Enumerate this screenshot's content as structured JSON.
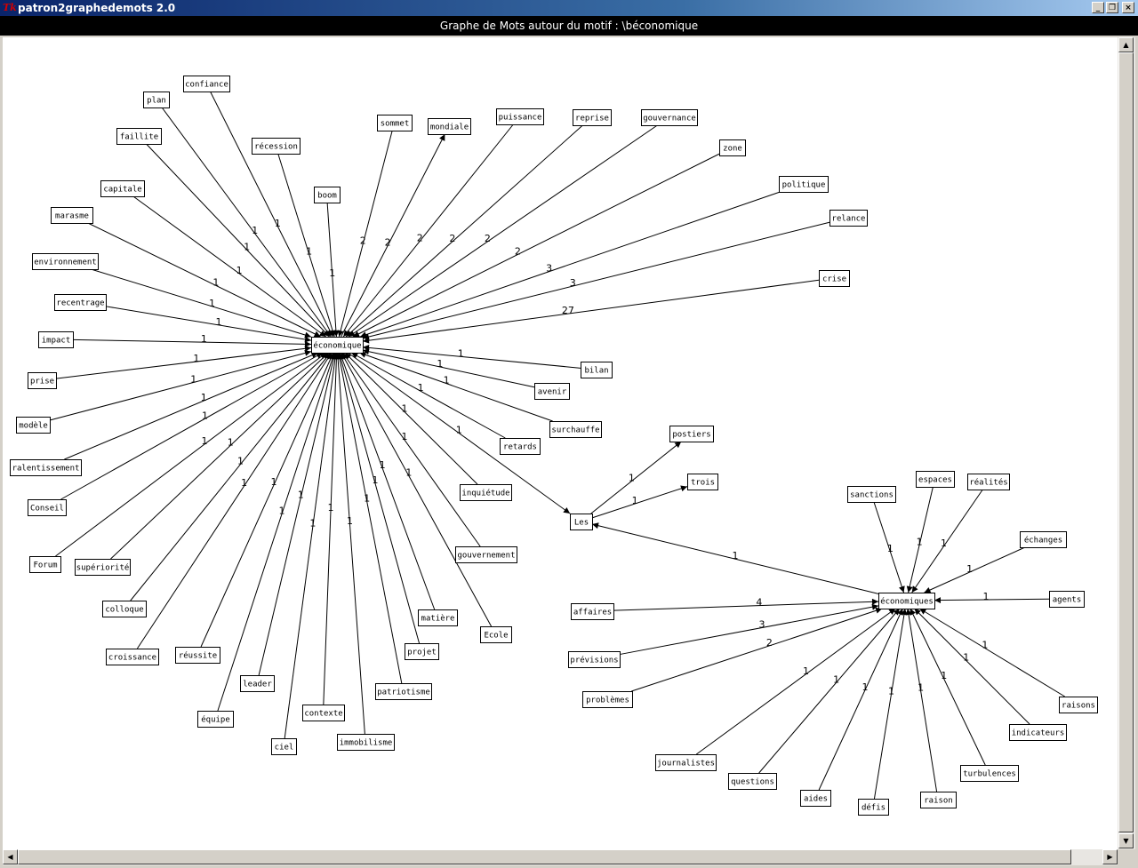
{
  "window": {
    "title": "patron2graphedemots 2.0",
    "icon": "tk-feather-icon",
    "buttons": [
      "_",
      "❐",
      "×"
    ]
  },
  "graph_title": "Graphe de Mots autour du motif : \\béconomique",
  "hub_labels": {
    "economique": "économique",
    "les": "Les",
    "economiques": "économiques"
  },
  "economique_neighbors": [
    {
      "label": "confiance",
      "weight": "1",
      "dir": "to_hub"
    },
    {
      "label": "plan",
      "weight": "1",
      "dir": "to_hub"
    },
    {
      "label": "faillite",
      "weight": "1",
      "dir": "to_hub"
    },
    {
      "label": "récession",
      "weight": "1",
      "dir": "to_hub"
    },
    {
      "label": "boom",
      "weight": "1",
      "dir": "to_hub"
    },
    {
      "label": "sommet",
      "weight": "2",
      "dir": "to_hub"
    },
    {
      "label": "mondiale",
      "weight": "2",
      "dir": "from_hub"
    },
    {
      "label": "puissance",
      "weight": "2",
      "dir": "to_hub"
    },
    {
      "label": "reprise",
      "weight": "2",
      "dir": "to_hub"
    },
    {
      "label": "gouvernance",
      "weight": "2",
      "dir": "to_hub"
    },
    {
      "label": "zone",
      "weight": "2",
      "dir": "to_hub"
    },
    {
      "label": "politique",
      "weight": "3",
      "dir": "to_hub"
    },
    {
      "label": "relance",
      "weight": "3",
      "dir": "to_hub"
    },
    {
      "label": "crise",
      "weight": "27",
      "dir": "to_hub"
    },
    {
      "label": "capitale",
      "weight": "1",
      "dir": "to_hub"
    },
    {
      "label": "marasme",
      "weight": "1",
      "dir": "to_hub"
    },
    {
      "label": "environnement",
      "weight": "1",
      "dir": "to_hub"
    },
    {
      "label": "recentrage",
      "weight": "1",
      "dir": "to_hub"
    },
    {
      "label": "impact",
      "weight": "1",
      "dir": "to_hub"
    },
    {
      "label": "prise",
      "weight": "1",
      "dir": "to_hub"
    },
    {
      "label": "modèle",
      "weight": "1",
      "dir": "to_hub"
    },
    {
      "label": "ralentissement",
      "weight": "1",
      "dir": "to_hub"
    },
    {
      "label": "Conseil",
      "weight": "1",
      "dir": "to_hub"
    },
    {
      "label": "Forum",
      "weight": "1",
      "dir": "to_hub"
    },
    {
      "label": "supériorité",
      "weight": "1",
      "dir": "to_hub"
    },
    {
      "label": "colloque",
      "weight": "1",
      "dir": "to_hub"
    },
    {
      "label": "croissance",
      "weight": "1",
      "dir": "to_hub"
    },
    {
      "label": "réussite",
      "weight": "1",
      "dir": "to_hub"
    },
    {
      "label": "équipe",
      "weight": "1",
      "dir": "to_hub"
    },
    {
      "label": "leader",
      "weight": "1",
      "dir": "to_hub"
    },
    {
      "label": "ciel",
      "weight": "1",
      "dir": "to_hub"
    },
    {
      "label": "contexte",
      "weight": "1",
      "dir": "to_hub"
    },
    {
      "label": "immobilisme",
      "weight": "1",
      "dir": "to_hub"
    },
    {
      "label": "patriotisme",
      "weight": "1",
      "dir": "to_hub"
    },
    {
      "label": "projet",
      "weight": "1",
      "dir": "to_hub"
    },
    {
      "label": "matière",
      "weight": "1",
      "dir": "to_hub"
    },
    {
      "label": "Ecole",
      "weight": "1",
      "dir": "to_hub"
    },
    {
      "label": "gouvernement",
      "weight": "1",
      "dir": "to_hub"
    },
    {
      "label": "inquiétude",
      "weight": "1",
      "dir": "to_hub"
    },
    {
      "label": "retards",
      "weight": "1",
      "dir": "to_hub"
    },
    {
      "label": "surchauffe",
      "weight": "1",
      "dir": "to_hub"
    },
    {
      "label": "avenir",
      "weight": "1",
      "dir": "to_hub"
    },
    {
      "label": "bilan",
      "weight": "1",
      "dir": "to_hub"
    }
  ],
  "economique_to_les": {
    "weight": "1"
  },
  "les_neighbors": [
    {
      "label": "postiers",
      "weight": "1"
    },
    {
      "label": "trois",
      "weight": "1"
    }
  ],
  "economiques_to_les": {
    "weight": "1"
  },
  "economiques_neighbors": [
    {
      "label": "sanctions",
      "weight": "1"
    },
    {
      "label": "espaces",
      "weight": "1"
    },
    {
      "label": "réalités",
      "weight": "1"
    },
    {
      "label": "échanges",
      "weight": "1"
    },
    {
      "label": "agents",
      "weight": "1"
    },
    {
      "label": "affaires",
      "weight": "4"
    },
    {
      "label": "prévisions",
      "weight": "3"
    },
    {
      "label": "problèmes",
      "weight": "2"
    },
    {
      "label": "raisons",
      "weight": "1"
    },
    {
      "label": "indicateurs",
      "weight": "1"
    },
    {
      "label": "turbulences",
      "weight": "1"
    },
    {
      "label": "raison",
      "weight": "1"
    },
    {
      "label": "défis",
      "weight": "1"
    },
    {
      "label": "aides",
      "weight": "1"
    },
    {
      "label": "questions",
      "weight": "1"
    },
    {
      "label": "journalistes",
      "weight": "1"
    }
  ]
}
